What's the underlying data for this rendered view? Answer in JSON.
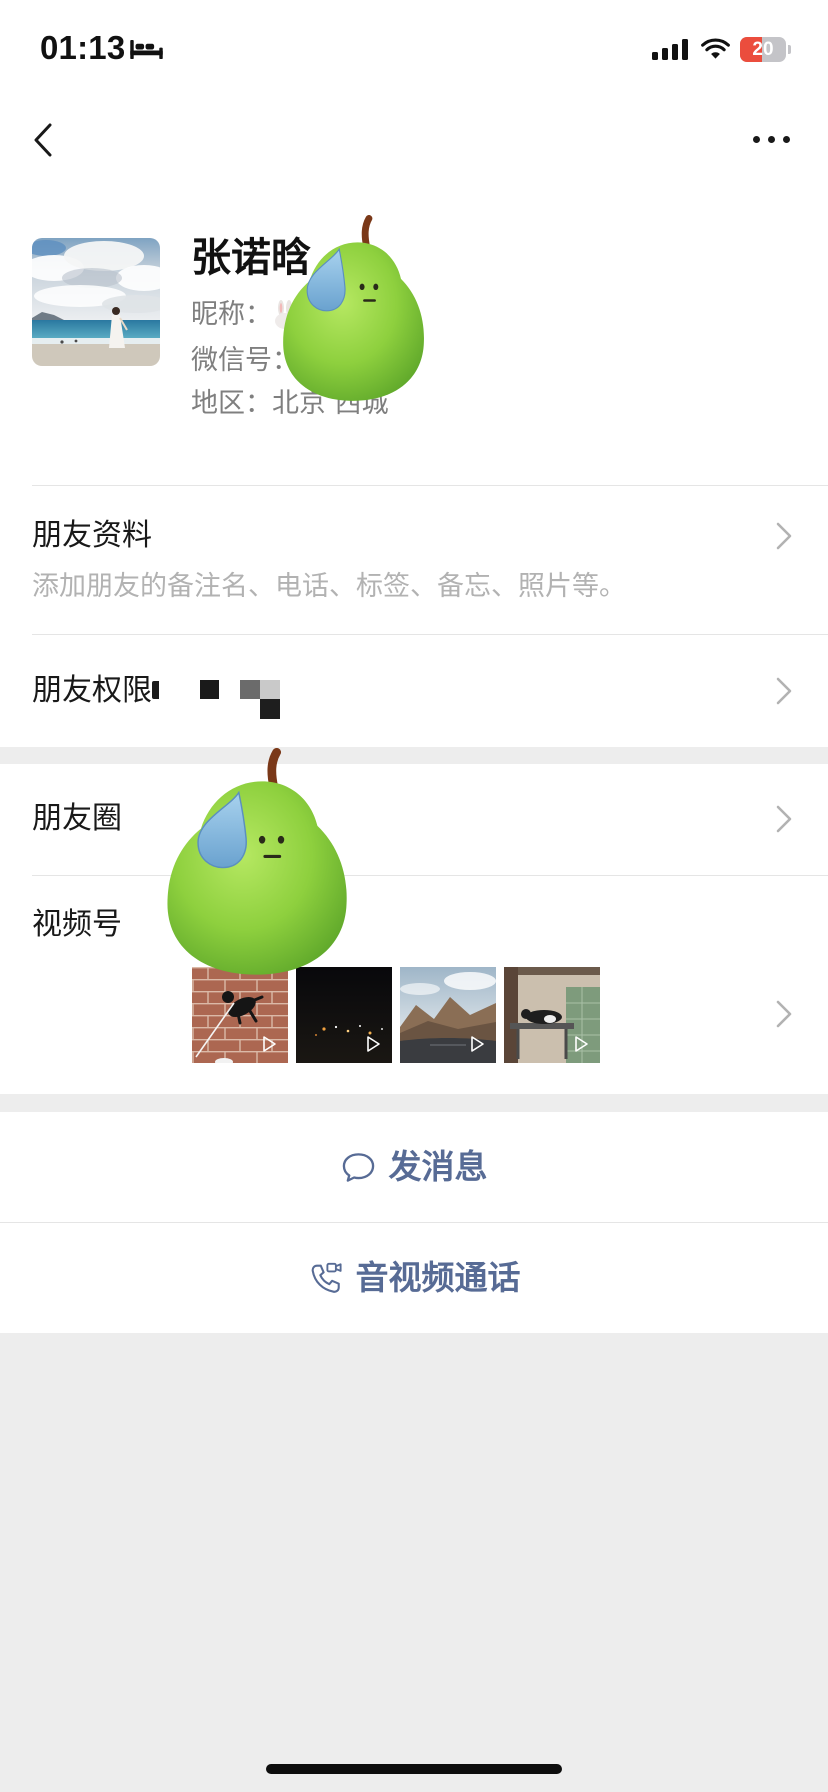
{
  "status_bar": {
    "time": "01:13",
    "battery_level": "20",
    "icons": [
      "bed-icon",
      "cellular-signal-icon",
      "wifi-icon",
      "battery-icon"
    ]
  },
  "nav_bar": {
    "left_icon": "chevron-left-icon",
    "right_icon": "more-dots-icon"
  },
  "profile": {
    "name": "张诺晗",
    "nickname_label": "昵称：",
    "nickname_icon": "rabbit-emoji-icon",
    "wechat_id_label": "微信号：",
    "region_label": "地区：",
    "region_value": "北京 西城"
  },
  "sections": {
    "friend_info": {
      "title": "朋友资料",
      "subtitle": "添加朋友的备注名、电话、标签、备忘、照片等。",
      "icon": "chevron-right-icon"
    },
    "friend_permissions": {
      "title": "朋友权限",
      "icon": "chevron-right-icon"
    },
    "moments": {
      "title": "朋友圈",
      "icon": "chevron-right-icon"
    },
    "channels": {
      "title": "视频号",
      "icon": "chevron-right-icon",
      "thumbnails": [
        {
          "icon": "play-icon"
        },
        {
          "icon": "play-icon"
        },
        {
          "icon": "play-icon"
        },
        {
          "icon": "play-icon"
        }
      ]
    }
  },
  "actions": {
    "send_message": {
      "label": "发消息",
      "icon": "chat-bubble-icon"
    },
    "av_call": {
      "label": "音视频通话",
      "icon": "video-call-icon"
    }
  },
  "stickers": [
    "pear-sticker",
    "pear-sticker"
  ],
  "colors": {
    "link": "#576b95",
    "page_background": "#ededed",
    "battery_low": "#eb4d3d",
    "secondary_text": "#7f7f7f",
    "hint_text": "#b2b2b2"
  }
}
